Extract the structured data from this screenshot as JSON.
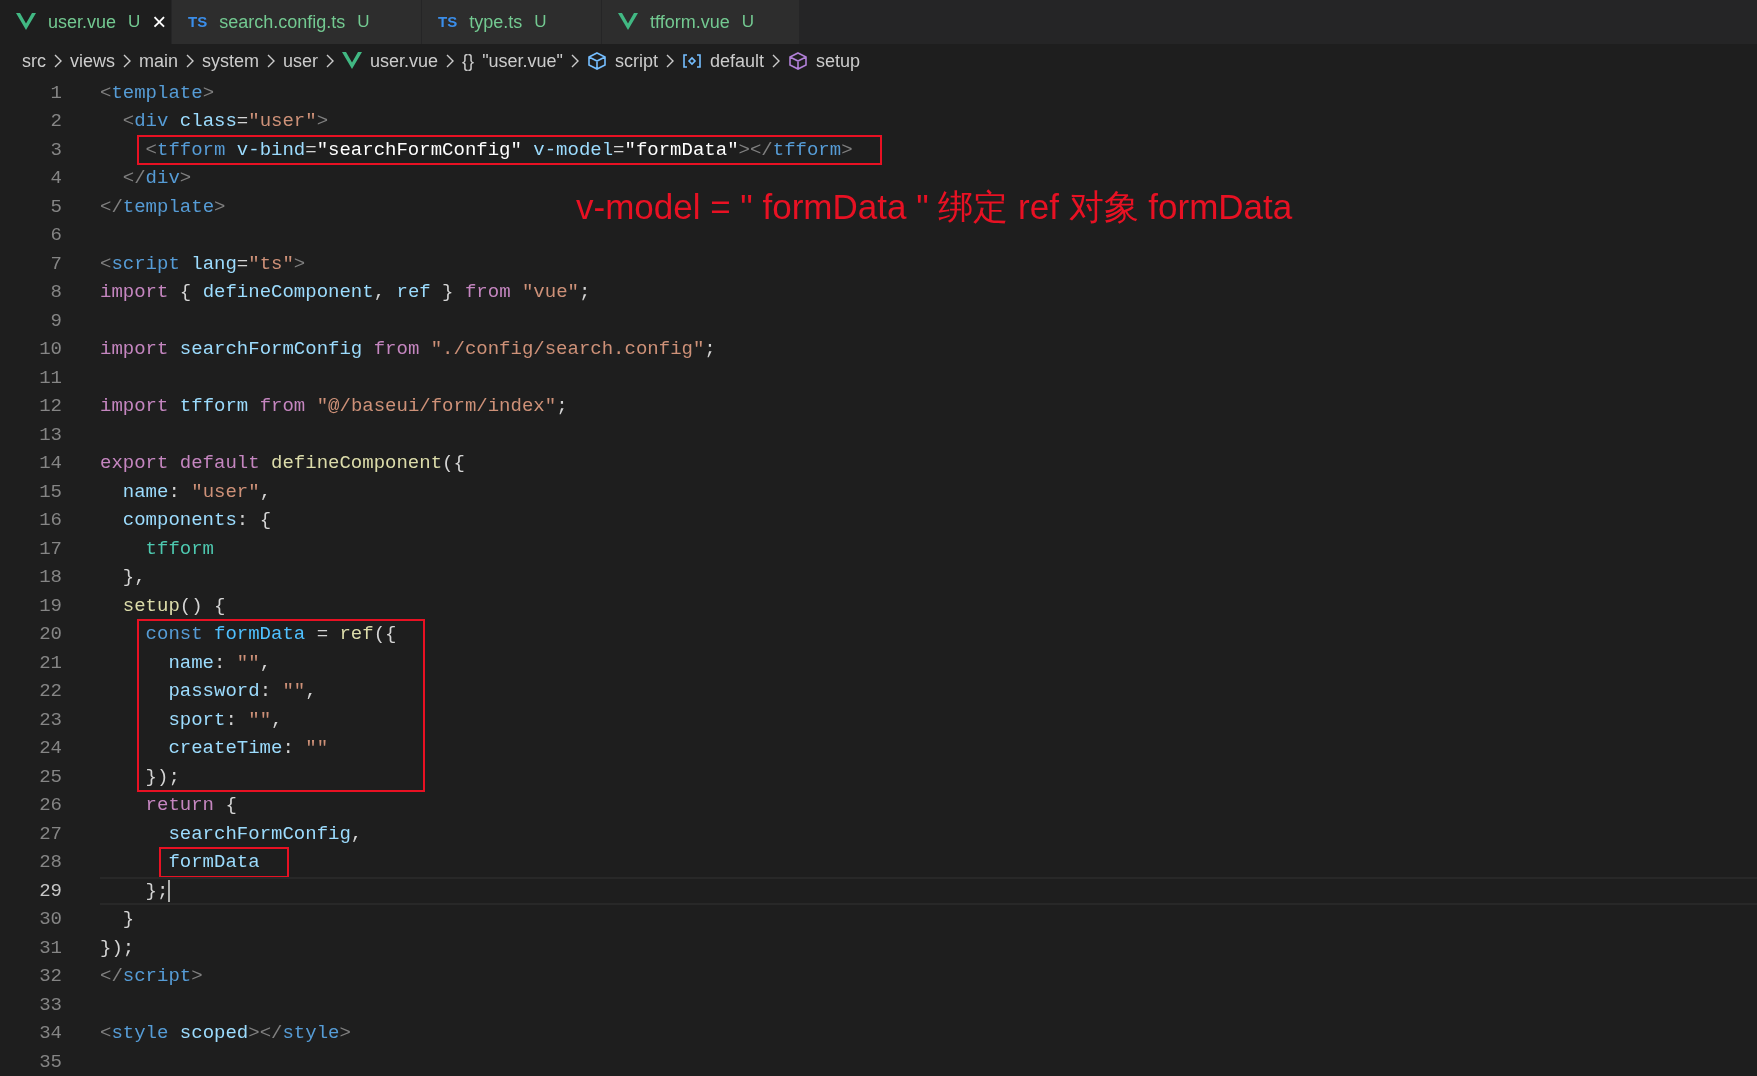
{
  "tabs": [
    {
      "label": "user.vue",
      "status": "U",
      "kind": "vue",
      "selected": true,
      "close": "×"
    },
    {
      "label": "search.config.ts",
      "status": "U",
      "kind": "ts",
      "icon_text": "TS",
      "selected": false
    },
    {
      "label": "type.ts",
      "status": "U",
      "kind": "ts",
      "icon_text": "TS",
      "selected": false
    },
    {
      "label": "tfform.vue",
      "status": "U",
      "kind": "vue",
      "selected": false
    }
  ],
  "breadcrumb": [
    {
      "label": "src",
      "kind": "folder"
    },
    {
      "label": "views",
      "kind": "folder"
    },
    {
      "label": "main",
      "kind": "folder"
    },
    {
      "label": "system",
      "kind": "folder"
    },
    {
      "label": "user",
      "kind": "folder"
    },
    {
      "label": "user.vue",
      "kind": "vue"
    },
    {
      "label": "\"user.vue\"",
      "kind": "braces",
      "icon_text": "{}"
    },
    {
      "label": "script",
      "kind": "module"
    },
    {
      "label": "default",
      "kind": "field"
    },
    {
      "label": "setup",
      "kind": "method"
    }
  ],
  "lines": [
    {
      "number": "1",
      "tokens": [
        {
          "t": "<",
          "kind": "p"
        },
        {
          "t": "template",
          "kind": "tag"
        },
        {
          "t": ">",
          "kind": "p"
        }
      ]
    },
    {
      "number": "2",
      "tokens": [
        {
          "t": "  <",
          "kind": "p"
        },
        {
          "t": "div",
          "kind": "tag"
        },
        {
          "t": " class",
          "kind": "attr"
        },
        {
          "t": "=",
          "kind": "plain"
        },
        {
          "t": "\"user\"",
          "kind": "str"
        },
        {
          "t": ">",
          "kind": "p"
        }
      ]
    },
    {
      "number": "3",
      "boxed": true,
      "tokens": [
        {
          "t": "    <",
          "kind": "p"
        },
        {
          "t": "tfform",
          "kind": "tag"
        },
        {
          "t": " v-bind",
          "kind": "attr"
        },
        {
          "t": "=",
          "kind": "plain"
        },
        {
          "t": "\"searchFormConfig\"",
          "kind": "str2"
        },
        {
          "t": " v-model",
          "kind": "attr"
        },
        {
          "t": "=",
          "kind": "plain"
        },
        {
          "t": "\"formData\"",
          "kind": "str2"
        },
        {
          "t": "></",
          "kind": "p"
        },
        {
          "t": "tfform",
          "kind": "tag"
        },
        {
          "t": ">",
          "kind": "p"
        }
      ]
    },
    {
      "number": "4",
      "tokens": [
        {
          "t": "  </",
          "kind": "p"
        },
        {
          "t": "div",
          "kind": "tag"
        },
        {
          "t": ">",
          "kind": "p"
        }
      ]
    },
    {
      "number": "5",
      "tokens": [
        {
          "t": "</",
          "kind": "p"
        },
        {
          "t": "template",
          "kind": "tag"
        },
        {
          "t": ">",
          "kind": "p"
        }
      ],
      "annotation": "v-model = \" formData \" 绑定 ref 对象 formData"
    },
    {
      "number": "6"
    },
    {
      "number": "7",
      "tokens": [
        {
          "t": "<",
          "kind": "p"
        },
        {
          "t": "script",
          "kind": "tag"
        },
        {
          "t": " lang",
          "kind": "attr"
        },
        {
          "t": "=",
          "kind": "plain"
        },
        {
          "t": "\"ts\"",
          "kind": "str"
        },
        {
          "t": ">",
          "kind": "p"
        }
      ]
    },
    {
      "number": "8",
      "tokens": [
        {
          "t": "import",
          "kind": "kw"
        },
        {
          "t": " { ",
          "kind": "plain"
        },
        {
          "t": "defineComponent",
          "kind": "var"
        },
        {
          "t": ", ",
          "kind": "plain"
        },
        {
          "t": "ref",
          "kind": "var"
        },
        {
          "t": " } ",
          "kind": "plain"
        },
        {
          "t": "from",
          "kind": "kw"
        },
        {
          "t": " \"vue\"",
          "kind": "str"
        },
        {
          "t": ";",
          "kind": "plain"
        }
      ]
    },
    {
      "number": "9"
    },
    {
      "number": "10",
      "tokens": [
        {
          "t": "import ",
          "kind": "kw"
        },
        {
          "t": "searchFormConfig ",
          "kind": "var"
        },
        {
          "t": "from ",
          "kind": "kw"
        },
        {
          "t": "\"./config/search.config\"",
          "kind": "str"
        },
        {
          "t": ";",
          "kind": "plain"
        }
      ]
    },
    {
      "number": "11"
    },
    {
      "number": "12",
      "tokens": [
        {
          "t": "import ",
          "kind": "kw"
        },
        {
          "t": "tfform ",
          "kind": "var"
        },
        {
          "t": "from ",
          "kind": "kw"
        },
        {
          "t": "\"@/baseui/form/index\"",
          "kind": "str"
        },
        {
          "t": ";",
          "kind": "plain"
        }
      ]
    },
    {
      "number": "13"
    },
    {
      "number": "14",
      "tokens": [
        {
          "t": "export default ",
          "kind": "kw"
        },
        {
          "t": "defineComponent",
          "kind": "fn"
        },
        {
          "t": "({",
          "kind": "plain"
        }
      ]
    },
    {
      "number": "15",
      "tokens": [
        {
          "t": "  name",
          "kind": "var"
        },
        {
          "t": ": ",
          "kind": "plain"
        },
        {
          "t": "\"user\"",
          "kind": "str"
        },
        {
          "t": ",",
          "kind": "plain"
        }
      ]
    },
    {
      "number": "16",
      "tokens": [
        {
          "t": "  components",
          "kind": "var"
        },
        {
          "t": ": {",
          "kind": "plain"
        }
      ]
    },
    {
      "number": "17",
      "tokens": [
        {
          "t": "    tfform",
          "kind": "comp"
        }
      ]
    },
    {
      "number": "18",
      "tokens": [
        {
          "t": "  },",
          "kind": "plain"
        }
      ]
    },
    {
      "number": "19",
      "tokens": [
        {
          "t": "  setup",
          "kind": "fn"
        },
        {
          "t": "() {",
          "kind": "plain"
        }
      ]
    },
    {
      "number": "20",
      "boxed": true,
      "tokens": [
        {
          "t": "    const ",
          "kind": "key"
        },
        {
          "t": "formData",
          "kind": "const"
        },
        {
          "t": " = ",
          "kind": "plain"
        },
        {
          "t": "ref",
          "kind": "fn"
        },
        {
          "t": "({",
          "kind": "plain"
        }
      ]
    },
    {
      "number": "21",
      "boxed": true,
      "tokens": [
        {
          "t": "      name",
          "kind": "var"
        },
        {
          "t": ": ",
          "kind": "plain"
        },
        {
          "t": "\"\"",
          "kind": "str"
        },
        {
          "t": ",",
          "kind": "plain"
        }
      ]
    },
    {
      "number": "22",
      "boxed": true,
      "tokens": [
        {
          "t": "      password",
          "kind": "var"
        },
        {
          "t": ": ",
          "kind": "plain"
        },
        {
          "t": "\"\"",
          "kind": "str"
        },
        {
          "t": ",",
          "kind": "plain"
        }
      ]
    },
    {
      "number": "23",
      "boxed": true,
      "tokens": [
        {
          "t": "      sport",
          "kind": "var"
        },
        {
          "t": ": ",
          "kind": "plain"
        },
        {
          "t": "\"\"",
          "kind": "str"
        },
        {
          "t": ",",
          "kind": "plain"
        }
      ]
    },
    {
      "number": "24",
      "boxed": true,
      "tokens": [
        {
          "t": "      createTime",
          "kind": "var"
        },
        {
          "t": ": ",
          "kind": "plain"
        },
        {
          "t": "\"\"",
          "kind": "str"
        }
      ]
    },
    {
      "number": "25",
      "boxed": true,
      "tokens": [
        {
          "t": "    });",
          "kind": "plain"
        }
      ]
    },
    {
      "number": "26",
      "tokens": [
        {
          "t": "    return",
          "kind": "kw"
        },
        {
          "t": " {",
          "kind": "plain"
        }
      ]
    },
    {
      "number": "27",
      "tokens": [
        {
          "t": "      searchFormConfig",
          "kind": "var"
        },
        {
          "t": ",",
          "kind": "plain"
        }
      ]
    },
    {
      "number": "28",
      "boxed": true,
      "tokens": [
        {
          "t": "      formData",
          "kind": "var"
        }
      ]
    },
    {
      "number": "29",
      "current": true,
      "tokens": [
        {
          "t": "    };",
          "kind": "plain"
        }
      ]
    },
    {
      "number": "30",
      "tokens": [
        {
          "t": "  }",
          "kind": "plain"
        }
      ]
    },
    {
      "number": "31",
      "tokens": [
        {
          "t": "});",
          "kind": "plain"
        }
      ]
    },
    {
      "number": "32",
      "tokens": [
        {
          "t": "</",
          "kind": "p"
        },
        {
          "t": "script",
          "kind": "tag"
        },
        {
          "t": ">",
          "kind": "p"
        }
      ]
    },
    {
      "number": "33"
    },
    {
      "number": "34",
      "tokens": [
        {
          "t": "<",
          "kind": "p"
        },
        {
          "t": "style",
          "kind": "tag"
        },
        {
          "t": " scoped",
          "kind": "attr"
        },
        {
          "t": "></",
          "kind": "p"
        },
        {
          "t": "style",
          "kind": "tag"
        },
        {
          "t": ">",
          "kind": "p"
        }
      ]
    },
    {
      "number": "35"
    }
  ]
}
